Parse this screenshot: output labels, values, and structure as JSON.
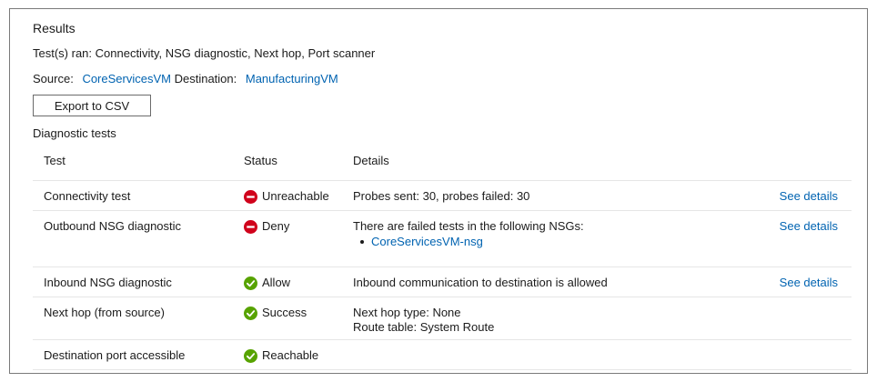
{
  "results": {
    "title": "Results",
    "tests_label": "Test(s) ran:",
    "tests_value": "Connectivity, NSG diagnostic, Next hop, Port scanner",
    "source_label": "Source:",
    "source_value": "CoreServicesVM",
    "destination_label": "Destination:",
    "destination_value": "ManufacturingVM",
    "export_label": "Export to CSV"
  },
  "diagnostic": {
    "title": "Diagnostic tests",
    "columns": [
      "Test",
      "Status",
      "Details"
    ],
    "rows": [
      {
        "test": "Connectivity test",
        "status": "Unreachable",
        "status_icon": "error-icon",
        "details": "Probes sent: 30, probes failed: 30",
        "link": "See details"
      },
      {
        "test": "Outbound NSG diagnostic",
        "status": "Deny",
        "status_icon": "error-icon",
        "details": "There are failed tests in the following NSGs:",
        "details_item": "CoreServicesVM-nsg",
        "link": "See details"
      },
      {
        "test": "Inbound NSG diagnostic",
        "status": "Allow",
        "status_icon": "success-icon",
        "details": "Inbound communication to destination is allowed",
        "link": "See details"
      },
      {
        "test": "Next hop (from source)",
        "status": "Success",
        "status_icon": "success-icon",
        "details": "Next hop type: None",
        "details_line2": "Route table: System Route"
      },
      {
        "test": "Destination port accessible",
        "status": "Reachable",
        "status_icon": "success-icon"
      }
    ]
  },
  "colors": {
    "link": "#0063b1",
    "error": "#d0021b",
    "success": "#57a300"
  }
}
